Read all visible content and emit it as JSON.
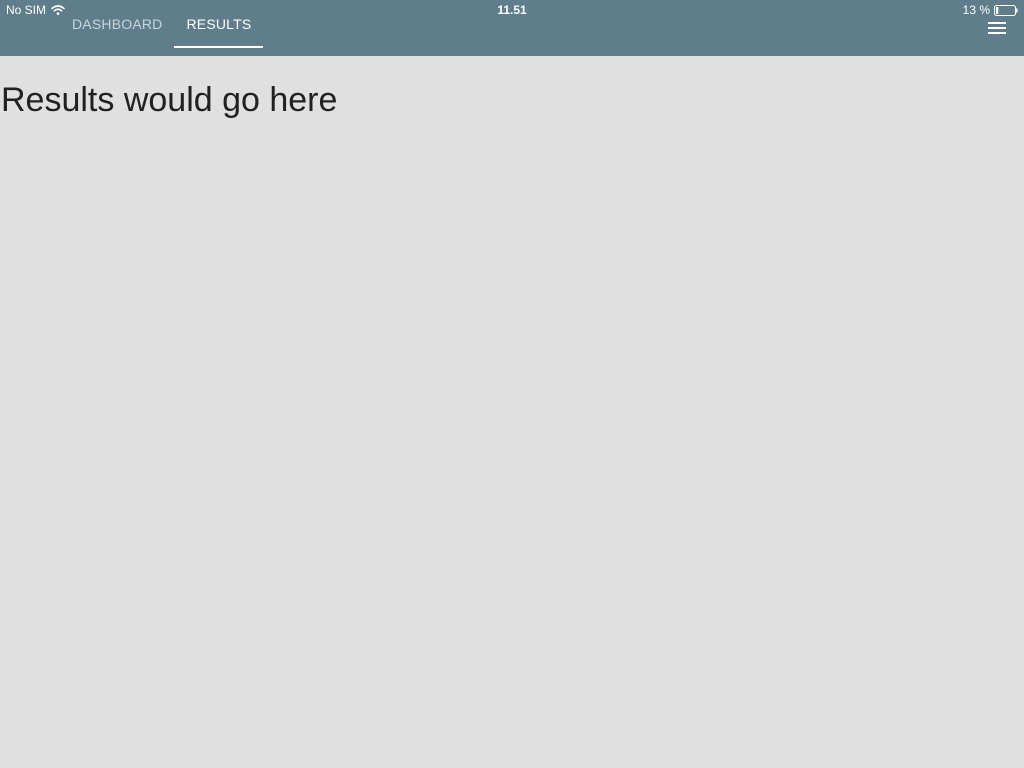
{
  "status_bar": {
    "carrier": "No SIM",
    "time": "11.51",
    "battery": "13 %",
    "battery_level": 0.13,
    "icons": [
      "wifi-icon",
      "battery-icon"
    ]
  },
  "tabs": [
    {
      "label": "DASHBOARD",
      "active": false
    },
    {
      "label": "RESULTS",
      "active": true
    }
  ],
  "header": {
    "menu_icon": "hamburger-menu-icon"
  },
  "main": {
    "text": "Results would go here"
  },
  "colors": {
    "toolbar": "#607d8b",
    "background": "#e0e0e0",
    "text": "#212121",
    "tab_inactive": "#c9d6dc",
    "tab_active": "#ffffff"
  }
}
